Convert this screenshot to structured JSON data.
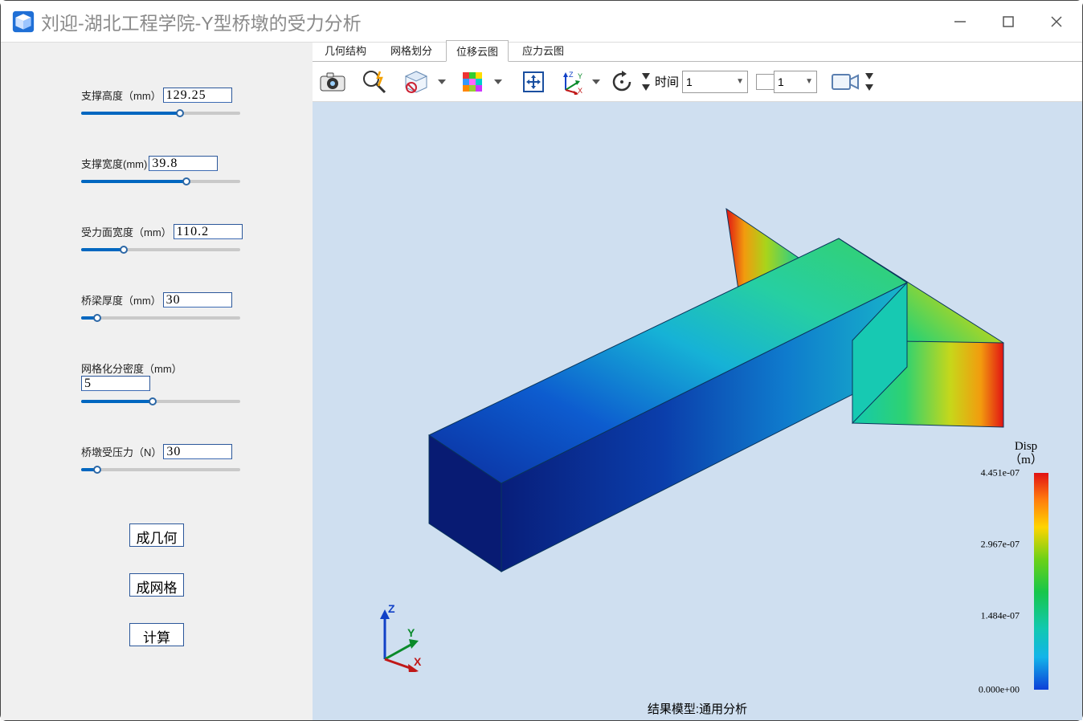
{
  "window_title": "刘迎-湖北工程学院-Y型桥墩的受力分析",
  "window_controls": {
    "min": "minimize-icon",
    "max": "maximize-icon",
    "close": "close-icon"
  },
  "sidebar": {
    "params": [
      {
        "label": "支撑高度（mm）",
        "value": "129.25",
        "fill_pct": 62
      },
      {
        "label": "支撑宽度(mm)",
        "value": "39.8",
        "fill_pct": 66
      },
      {
        "label": "受力面宽度（mm）",
        "value": "110.2",
        "fill_pct": 27
      },
      {
        "label": "桥梁厚度（mm）",
        "value": "30",
        "fill_pct": 10
      },
      {
        "label": "网格化分密度（mm）",
        "value": "5",
        "fill_pct": 45
      },
      {
        "label": "桥墩受压力（N）",
        "value": "30",
        "fill_pct": 10
      }
    ],
    "buttons": [
      {
        "label": "成几何"
      },
      {
        "label": "成网格"
      },
      {
        "label": "计算"
      }
    ]
  },
  "tabs": [
    {
      "label": "几何结构",
      "active": false
    },
    {
      "label": "网格划分",
      "active": false
    },
    {
      "label": "位移云图",
      "active": true
    },
    {
      "label": "应力云图",
      "active": false
    }
  ],
  "toolbar": {
    "time_label": "时间",
    "time_value": "1",
    "frame_value": "1"
  },
  "legend": {
    "title_line1": "Disp",
    "title_line2": "（m）",
    "max": "4.451e-07",
    "mid1": "2.967e-07",
    "mid2": "1.484e-07",
    "min": "0.000e+00"
  },
  "triad": {
    "x": "X",
    "y": "Y",
    "z": "Z"
  },
  "status_text": "结果模型:通用分析"
}
